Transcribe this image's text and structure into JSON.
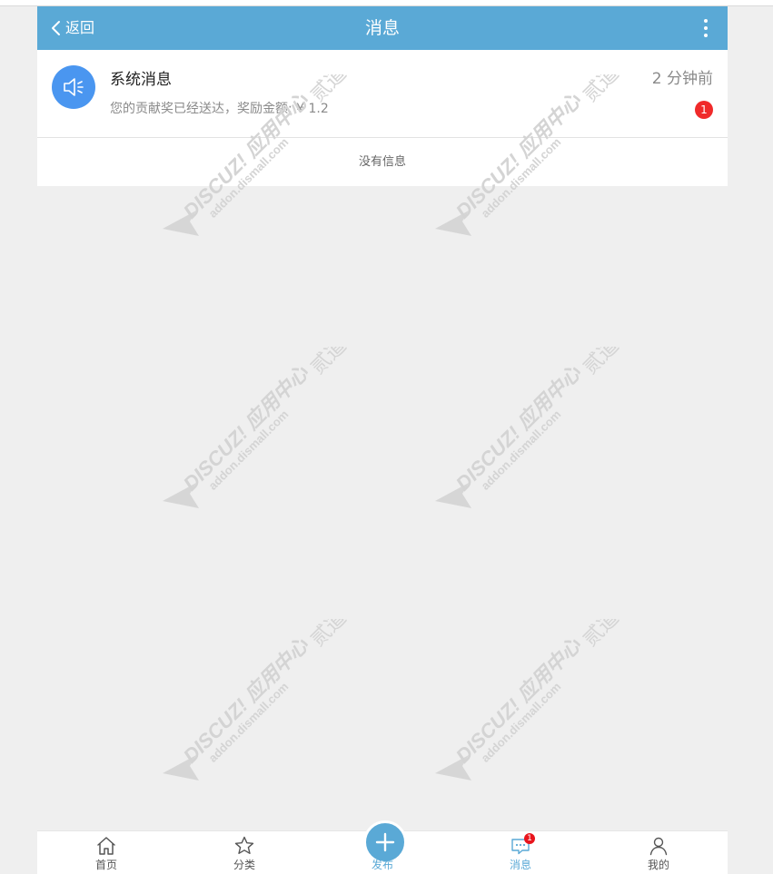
{
  "header": {
    "back_label": "返回",
    "title": "消息"
  },
  "message": {
    "title": "系统消息",
    "text": "您的贡献奖已经送达，奖励金额: ¥ 1.2",
    "time": "2 分钟前",
    "badge": "1",
    "icon": "speaker-icon"
  },
  "empty_text": "没有信息",
  "watermark": {
    "brand": "DISCUZ!",
    "subtitle": "应用中心",
    "url": "addon.dismall.com",
    "mark": "贰道"
  },
  "tabbar": {
    "items": [
      {
        "label": "首页",
        "icon": "home-icon"
      },
      {
        "label": "分类",
        "icon": "star-icon"
      },
      {
        "label": "发布",
        "icon": "plus-icon"
      },
      {
        "label": "消息",
        "icon": "message-icon",
        "badge": "1"
      },
      {
        "label": "我的",
        "icon": "user-icon"
      }
    ],
    "active_index": 3
  },
  "colors": {
    "primary": "#5aa9d6",
    "avatar": "#4a96f0",
    "badge": "#f02a2a",
    "background": "#efefef"
  }
}
